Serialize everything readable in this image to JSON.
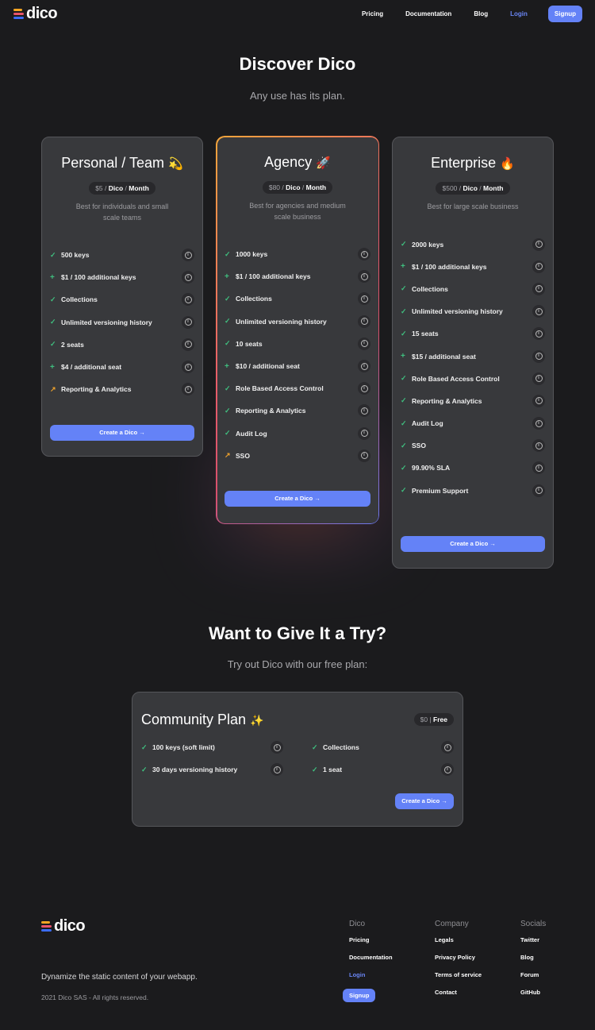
{
  "brand": {
    "name": "dico",
    "logo_colors": [
      "#f5a623",
      "#e8546b",
      "#3b6cf6"
    ]
  },
  "nav": {
    "items": [
      {
        "label": "Pricing"
      },
      {
        "label": "Documentation"
      },
      {
        "label": "Blog"
      },
      {
        "label": "Login"
      }
    ],
    "signup": "Signup"
  },
  "hero": {
    "title": "Discover Dico",
    "subtitle": "Any use has its plan."
  },
  "plans": [
    {
      "name": "Personal / Team",
      "emoji": "💫",
      "price": "$5",
      "unit1": "Dico",
      "unit2": "Month",
      "desc": "Best for individuals and small scale teams",
      "features": [
        {
          "icon": "check",
          "text": "500 keys"
        },
        {
          "icon": "plus",
          "text": "$1 / 100 additional keys"
        },
        {
          "icon": "check",
          "text": "Collections"
        },
        {
          "icon": "check",
          "text": "Unlimited versioning history"
        },
        {
          "icon": "check",
          "text": "2 seats"
        },
        {
          "icon": "plus",
          "text": "$4 / additional seat"
        },
        {
          "icon": "trend-up",
          "text": "Reporting & Analytics"
        }
      ],
      "cta": "Create a Dico →"
    },
    {
      "name": "Agency",
      "emoji": "🚀",
      "price": "$80",
      "unit1": "Dico",
      "unit2": "Month",
      "desc": "Best for agencies and medium scale business",
      "features": [
        {
          "icon": "check",
          "text": "1000 keys"
        },
        {
          "icon": "plus",
          "text": "$1 / 100 additional keys"
        },
        {
          "icon": "check",
          "text": "Collections"
        },
        {
          "icon": "check",
          "text": "Unlimited versioning history"
        },
        {
          "icon": "check",
          "text": "10 seats"
        },
        {
          "icon": "plus",
          "text": "$10 / additional seat"
        },
        {
          "icon": "check",
          "text": "Role Based Access Control"
        },
        {
          "icon": "check",
          "text": "Reporting & Analytics"
        },
        {
          "icon": "check",
          "text": "Audit Log"
        },
        {
          "icon": "trend-up",
          "text": "SSO"
        }
      ],
      "cta": "Create a Dico →"
    },
    {
      "name": "Enterprise",
      "emoji": "🔥",
      "price": "$500",
      "unit1": "Dico",
      "unit2": "Month",
      "desc": "Best for large scale business",
      "features": [
        {
          "icon": "check",
          "text": "2000 keys"
        },
        {
          "icon": "plus",
          "text": "$1 / 100 additional keys"
        },
        {
          "icon": "check",
          "text": "Collections"
        },
        {
          "icon": "check",
          "text": "Unlimited versioning history"
        },
        {
          "icon": "check",
          "text": "15 seats"
        },
        {
          "icon": "plus",
          "text": "$15 / additional seat"
        },
        {
          "icon": "check",
          "text": "Role Based Access Control"
        },
        {
          "icon": "check",
          "text": "Reporting & Analytics"
        },
        {
          "icon": "check",
          "text": "Audit Log"
        },
        {
          "icon": "check",
          "text": "SSO"
        },
        {
          "icon": "check",
          "text": "99.90% SLA"
        },
        {
          "icon": "check",
          "text": "Premium Support"
        }
      ],
      "cta": "Create a Dico →"
    }
  ],
  "try": {
    "title": "Want to Give It a Try?",
    "subtitle": "Try out Dico with our free plan:"
  },
  "community": {
    "name": "Community Plan",
    "emoji": "✨",
    "price": "$0",
    "price_label": "Free",
    "features": [
      {
        "icon": "check",
        "text": "100 keys (soft limit)"
      },
      {
        "icon": "check",
        "text": "Collections"
      },
      {
        "icon": "check",
        "text": "30 days versioning history"
      },
      {
        "icon": "check",
        "text": "1 seat"
      }
    ],
    "cta": "Create a Dico →"
  },
  "footer": {
    "tagline": "Dynamize the static content of your webapp.",
    "copyright": "2021 Dico SAS - All rights reserved.",
    "columns": [
      {
        "title": "Dico",
        "links": [
          "Pricing",
          "Documentation",
          "Login",
          "Signup"
        ]
      },
      {
        "title": "Company",
        "links": [
          "Legals",
          "Privacy Policy",
          "Terms of service",
          "Contact"
        ]
      },
      {
        "title": "Socials",
        "links": [
          "Twitter",
          "Blog",
          "Forum",
          "GitHub"
        ]
      }
    ]
  }
}
